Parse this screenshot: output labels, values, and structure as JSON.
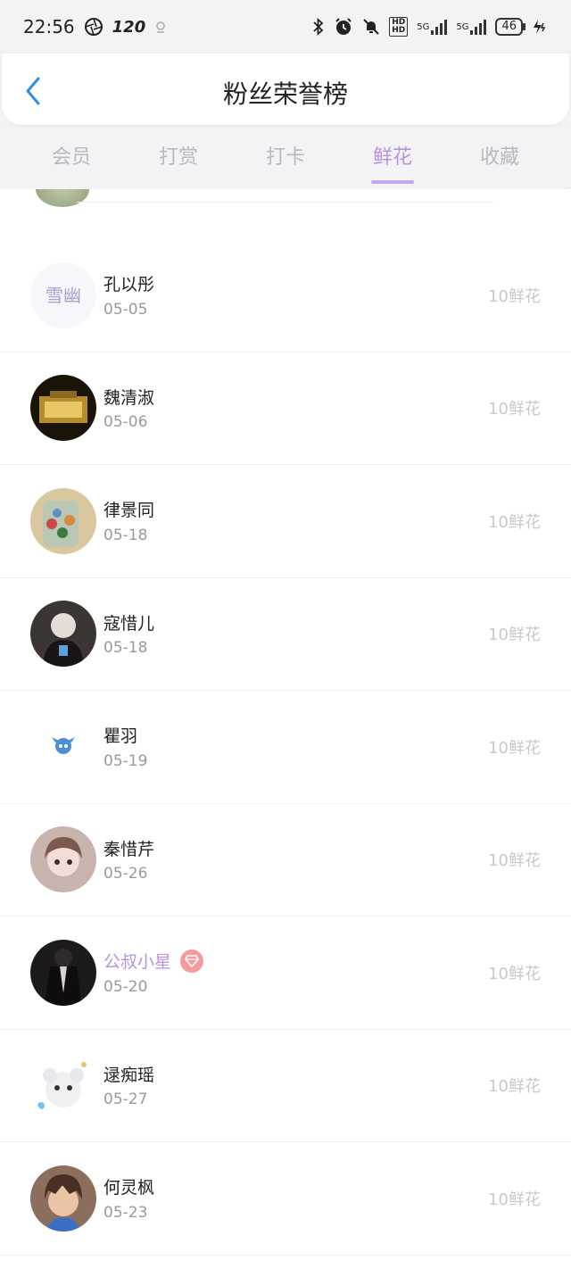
{
  "status_bar": {
    "time": "22:56",
    "refresh_rate": "120",
    "battery": "46",
    "net1": "5G",
    "net2": "5G"
  },
  "header": {
    "title": "粉丝荣誉榜"
  },
  "tabs": [
    {
      "label": "会员",
      "active": false
    },
    {
      "label": "打赏",
      "active": false
    },
    {
      "label": "打卡",
      "active": false
    },
    {
      "label": "鲜花",
      "active": true
    },
    {
      "label": "收藏",
      "active": false
    }
  ],
  "colors": {
    "accent": "#b892e0",
    "muted": "#c9c9cc",
    "date": "#9a9a9e",
    "vip_badge": "#f49b9b"
  },
  "rows": [
    {
      "name": "孔以彤",
      "date": "05-05",
      "value": "10鲜花",
      "vip": false,
      "avatar": "text-logo"
    },
    {
      "name": "魏清淑",
      "date": "05-06",
      "value": "10鲜花",
      "vip": false,
      "avatar": "golden-building"
    },
    {
      "name": "律景同",
      "date": "05-18",
      "value": "10鲜花",
      "vip": false,
      "avatar": "candy-jar"
    },
    {
      "name": "寇惜儿",
      "date": "05-18",
      "value": "10鲜花",
      "vip": false,
      "avatar": "person-dark"
    },
    {
      "name": "瞿羽",
      "date": "05-19",
      "value": "10鲜花",
      "vip": false,
      "avatar": "blue-character"
    },
    {
      "name": "秦惜芹",
      "date": "05-26",
      "value": "10鲜花",
      "vip": false,
      "avatar": "anime-girl"
    },
    {
      "name": "公叔小星",
      "date": "05-20",
      "value": "10鲜花",
      "vip": true,
      "avatar": "person-black"
    },
    {
      "name": "逯痴瑶",
      "date": "05-27",
      "value": "10鲜花",
      "vip": false,
      "avatar": "white-bear"
    },
    {
      "name": "何灵枫",
      "date": "05-23",
      "value": "10鲜花",
      "vip": false,
      "avatar": "anime-boy"
    }
  ]
}
